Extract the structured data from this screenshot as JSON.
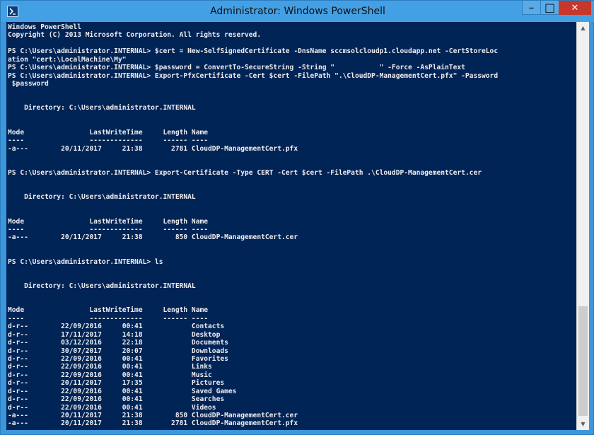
{
  "window": {
    "title": "Administrator: Windows PowerShell",
    "minimize_glyph": "–",
    "maximize_glyph": "□",
    "close_glyph": "✕"
  },
  "scrollbar": {
    "up_glyph": "▲",
    "down_glyph": "▼"
  },
  "console": {
    "lines": [
      "Windows PowerShell",
      "Copyright (C) 2013 Microsoft Corporation. All rights reserved.",
      "",
      "PS C:\\Users\\administrator.INTERNAL> $cert = New-SelfSignedCertificate -DnsName sccmsolcloudp1.cloudapp.net -CertStoreLoc",
      "ation \"cert:\\LocalMachine\\My\"",
      "PS C:\\Users\\administrator.INTERNAL> $password = ConvertTo-SecureString -String \"           \" -Force -AsPlainText",
      "PS C:\\Users\\administrator.INTERNAL> Export-PfxCertificate -Cert $cert -FilePath \".\\CloudDP-ManagementCert.pfx\" -Password",
      " $password",
      "",
      "",
      "    Directory: C:\\Users\\administrator.INTERNAL",
      "",
      "",
      "Mode                LastWriteTime     Length Name",
      "----                -------------     ------ ----",
      "-a---        20/11/2017     21:38       2781 CloudDP-ManagementCert.pfx",
      "",
      "",
      "PS C:\\Users\\administrator.INTERNAL> Export-Certificate -Type CERT -Cert $cert -FilePath .\\CloudDP-ManagementCert.cer",
      "",
      "",
      "    Directory: C:\\Users\\administrator.INTERNAL",
      "",
      "",
      "Mode                LastWriteTime     Length Name",
      "----                -------------     ------ ----",
      "-a---        20/11/2017     21:38        850 CloudDP-ManagementCert.cer",
      "",
      "",
      "PS C:\\Users\\administrator.INTERNAL> ls",
      "",
      "",
      "    Directory: C:\\Users\\administrator.INTERNAL",
      "",
      "",
      "Mode                LastWriteTime     Length Name",
      "----                -------------     ------ ----",
      "d-r--        22/09/2016     00:41            Contacts",
      "d-r--        17/11/2017     14:18            Desktop",
      "d-r--        03/12/2016     22:18            Documents",
      "d-r--        30/07/2017     20:07            Downloads",
      "d-r--        22/09/2016     00:41            Favorites",
      "d-r--        22/09/2016     00:41            Links",
      "d-r--        22/09/2016     00:41            Music",
      "d-r--        20/11/2017     17:35            Pictures",
      "d-r--        22/09/2016     00:41            Saved Games",
      "d-r--        22/09/2016     00:41            Searches",
      "d-r--        22/09/2016     00:41            Videos",
      "-a---        20/11/2017     21:38        850 CloudDP-ManagementCert.cer",
      "-a---        20/11/2017     21:38       2781 CloudDP-ManagementCert.pfx"
    ]
  }
}
